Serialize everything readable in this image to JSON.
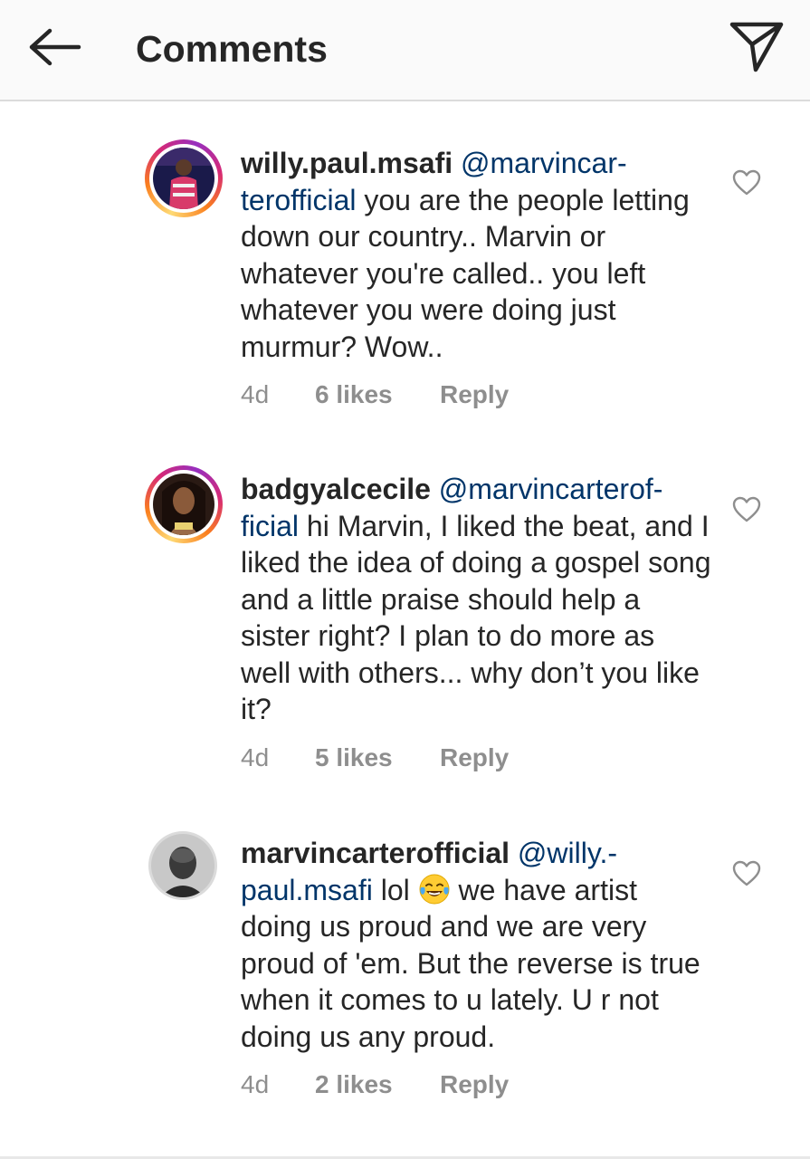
{
  "header": {
    "title": "Comments"
  },
  "comments": [
    {
      "username": "willy.paul.msafi",
      "mention": "@marvincar-terofficial",
      "mention_line1": "@marvincar-",
      "mention_line2": "terofficial",
      "text_line1": "you are the people",
      "text_rest": "letting down our country.. Marvin or whatever you're called.. you left whatever you were doing just murmur? Wow..",
      "time": "4d",
      "likes": "6 likes",
      "reply": "Reply",
      "avatar_icon": "person-photo",
      "ring": true
    },
    {
      "username": "badgyalcecile",
      "mention": "@marvincarterof-ficial",
      "mention_line1": "@marvincarterof-",
      "mention_line2": "ficial",
      "text_line1": "hi Marvin, I liked the beat,",
      "text_rest": "and I liked the idea of doing a gospel song and a little praise should help a sister right? I plan to do more as well with others... why don’t you like it?",
      "time": "4d",
      "likes": "5 likes",
      "reply": "Reply",
      "avatar_icon": "person-photo",
      "ring": true
    },
    {
      "username": "marvincarterofficial",
      "mention": "@willy.-paul.msafi",
      "mention_line1": "@willy.-",
      "mention_line2": "paul.msafi",
      "text_line1": "lol",
      "emoji": "tears-of-joy-emoji",
      "text_line1b": "we have artist",
      "text_rest": "doing us proud and we are very proud of 'em. But the reverse is true when it comes to u lately. U r not doing us any proud.",
      "time": "4d",
      "likes": "2 likes",
      "reply": "Reply",
      "avatar_icon": "person-photo",
      "ring": false
    }
  ],
  "icons": {
    "back": "arrow-left-icon",
    "share": "paper-plane-icon",
    "like": "heart-outline-icon"
  },
  "colors": {
    "mention": "#003569",
    "meta": "#8e8e8e",
    "header_bg": "#fafafa"
  }
}
